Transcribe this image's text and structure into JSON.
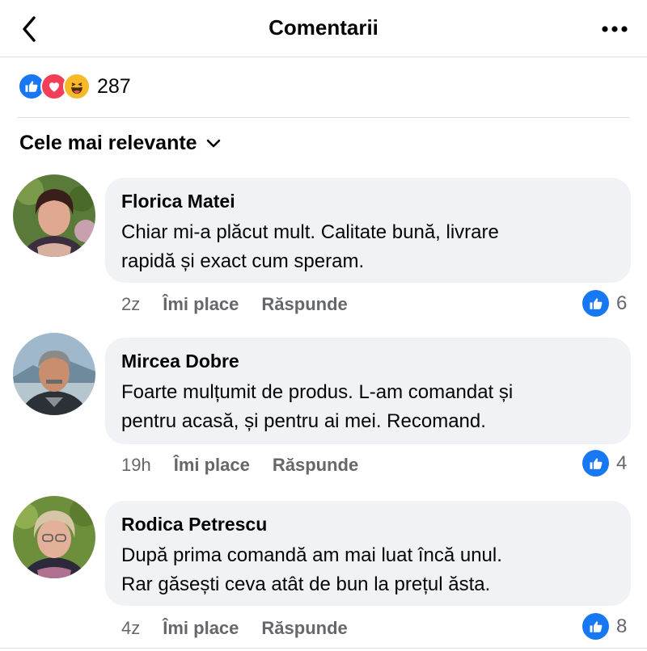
{
  "header": {
    "title": "Comentarii"
  },
  "reactions": {
    "count": "287",
    "types": [
      "like-icon",
      "love-icon",
      "haha-icon"
    ]
  },
  "sort": {
    "label": "Cele mai relevante"
  },
  "comments": [
    {
      "name": "Florica Matei",
      "lines": [
        "Chiar mi-a plăcut mult. Calitate bună, livrare",
        "rapidă și exact cum speram."
      ],
      "time": "2z",
      "like_label": "Îmi place",
      "reply_label": "Răspunde",
      "likes": "6"
    },
    {
      "name": "Mircea Dobre",
      "lines": [
        "Foarte mulțumit de produs. L-am comandat și",
        "pentru acasă, și pentru ai mei. Recomand."
      ],
      "time": "19h",
      "like_label": "Îmi place",
      "reply_label": "Răspunde",
      "likes": "4"
    },
    {
      "name": "Rodica Petrescu",
      "lines": [
        "După prima comandă am mai luat încă unul.",
        "Rar găsești ceva atât de bun la prețul ăsta."
      ],
      "time": "4z",
      "like_label": "Îmi place",
      "reply_label": "Răspunde",
      "likes": "8"
    }
  ],
  "colors": {
    "like_blue": "#1877f2",
    "bubble": "#f0f2f5",
    "meta_gray": "#65676b"
  }
}
